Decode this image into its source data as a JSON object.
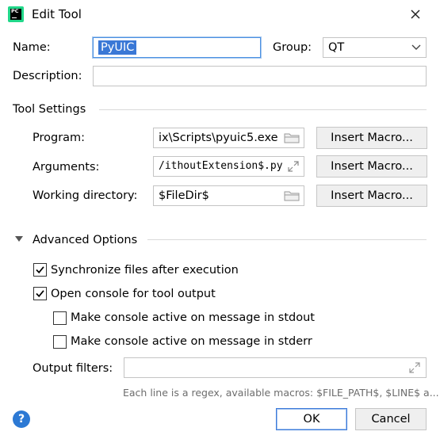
{
  "window": {
    "title": "Edit Tool"
  },
  "form": {
    "name_label": "Name:",
    "name_value": "PyUIC",
    "group_label": "Group:",
    "group_value": "QT",
    "description_label": "Description:",
    "description_value": ""
  },
  "tool_settings": {
    "heading": "Tool Settings",
    "program_label": "Program:",
    "program_value": "ix\\Scripts\\pyuic5.exe",
    "arguments_label": "Arguments:",
    "arguments_value": "/ithoutExtension$.py",
    "working_dir_label": "Working directory:",
    "working_dir_value": "$FileDir$",
    "insert_macro_label": "Insert Macro..."
  },
  "advanced": {
    "heading": "Advanced Options",
    "sync_files_label": "Synchronize files after execution",
    "sync_files_checked": true,
    "open_console_label": "Open console for tool output",
    "open_console_checked": true,
    "console_stdout_label": "Make console active on message in stdout",
    "console_stdout_checked": false,
    "console_stderr_label": "Make console active on message in stderr",
    "console_stderr_checked": false,
    "output_filters_label": "Output filters:",
    "output_filters_value": "",
    "hint": "Each line is a regex, available macros: $FILE_PATH$, $LINE$ a..."
  },
  "footer": {
    "ok_label": "OK",
    "cancel_label": "Cancel",
    "help_label": "?"
  },
  "icons": {
    "app": "pycharm-app-icon",
    "close": "close-icon",
    "dropdown": "chevron-down-icon",
    "folder": "folder-icon",
    "expand": "expand-icon",
    "collapse_triangle": "triangle-down-icon",
    "help": "help-icon"
  },
  "colors": {
    "accent": "#3a78d6",
    "app_icon": "#21d789",
    "help": "#2c79d4"
  }
}
